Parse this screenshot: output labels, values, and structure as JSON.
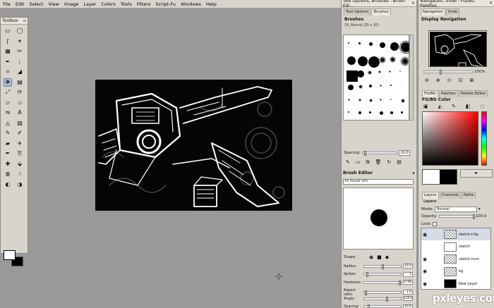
{
  "menu": [
    "File",
    "Edit",
    "Select",
    "View",
    "Image",
    "Layer",
    "Colors",
    "Tools",
    "Filters",
    "Script-Fu",
    "Windows",
    "Help"
  ],
  "toolbox": {
    "title": "Toolbox",
    "tools": [
      "rect-select",
      "ellipse-select",
      "free-select",
      "fuzzy-select",
      "select-by-color",
      "scissors",
      "paths",
      "color-picker",
      "crop",
      "measure",
      "move",
      "align",
      "scale",
      "rotate",
      "shear",
      "perspective",
      "flip",
      "text",
      "bucket-fill",
      "blend",
      "pencil",
      "paintbrush",
      "eraser",
      "airbrush",
      "ink",
      "clone",
      "heal",
      "perspective-clone",
      "blur",
      "smudge",
      "dodge",
      "burn",
      "ink-drop",
      "eyedropper"
    ]
  },
  "dock1": {
    "title": "Tool Options, Brushes - Brush Edi...",
    "tabs": [
      "Tool Options",
      "Brushes"
    ],
    "brushes_label": "Brushes",
    "brush_caption": "19_Round (20 x 20)",
    "spacing_label": "Spacing:",
    "spacing_value": "10.0",
    "editor_title": "Brush Editor",
    "editor_name": "19_Round 10%",
    "shape_label": "Shape:",
    "params": [
      {
        "label": "Radius:",
        "value": "10.0",
        "level": 0.48
      },
      {
        "label": "Spikes:",
        "value": "2",
        "level": 0.05
      },
      {
        "label": "Hardness:",
        "value": "0.98",
        "level": 0.95
      },
      {
        "label": "Aspect ratio:",
        "value": "1.0",
        "level": 0.02
      },
      {
        "label": "Angle:",
        "value": "120.0",
        "level": 0.6
      },
      {
        "label": "Spacing:",
        "value": "10.0",
        "level": 0.1
      }
    ]
  },
  "dock2": {
    "title": "Navigation, Undo - FG/BG, Palettes...",
    "nav_tabs": [
      "Navigation",
      "Undo"
    ],
    "nav_label": "Display Navigation",
    "zoom": "100%",
    "color_tabs": [
      "FG/BG",
      "Palettes",
      "Palette Editor"
    ],
    "fgbg_label": "FG/BG Color",
    "layer_tabs": [
      "Layers",
      "Channels",
      "Paths"
    ],
    "layers_label": "Layers",
    "mode_label": "Mode:",
    "mode_value": "Normal",
    "opacity_label": "Opacity:",
    "opacity_value": "100.0",
    "lock_label": "Lock:",
    "layers": [
      {
        "name": "sketch+hip",
        "thumb": "checker",
        "visible": true,
        "selected": true
      },
      {
        "name": "sketch",
        "thumb": "white",
        "visible": false,
        "selected": false
      },
      {
        "name": "sketch-hum",
        "thumb": "checker",
        "visible": true,
        "selected": false
      },
      {
        "name": "bg",
        "thumb": "checker",
        "visible": true,
        "selected": false
      },
      {
        "name": "New Layer",
        "thumb": "black",
        "visible": true,
        "selected": false
      }
    ]
  },
  "watermark": "pxleyes.com"
}
